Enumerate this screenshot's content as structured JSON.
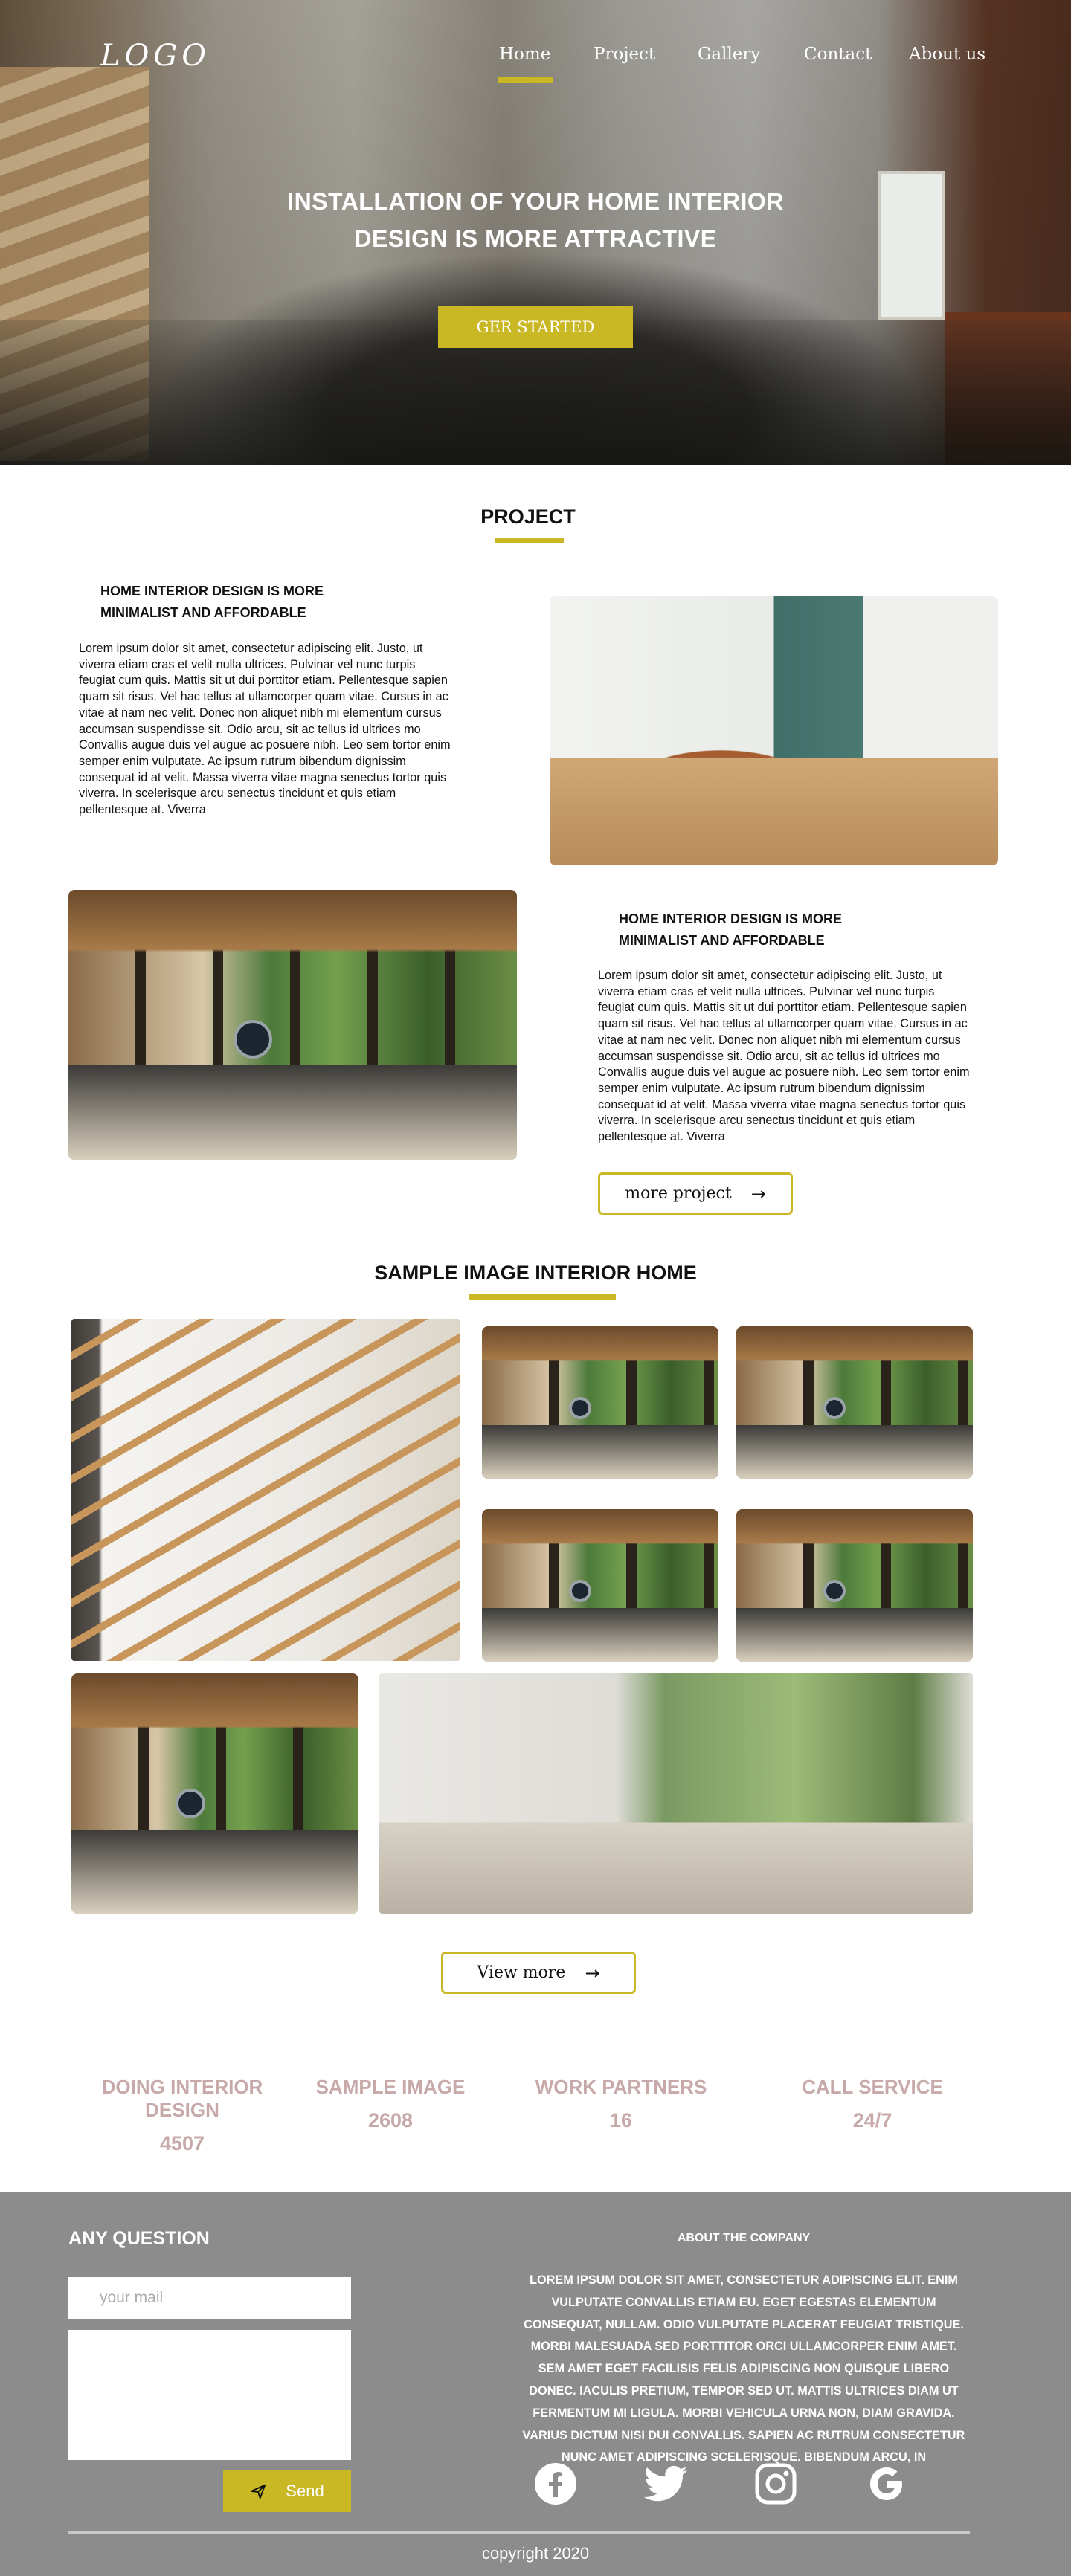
{
  "brand": {
    "logo": "LOGO",
    "accent": "#c9b723"
  },
  "nav": {
    "items": [
      "Home",
      "Project",
      "Gallery",
      "Contact",
      "About us"
    ],
    "active": "Home"
  },
  "hero": {
    "title_line1": "INSTALLATION OF YOUR HOME INTERIOR",
    "title_line2": "DESIGN IS MORE ATTRACTIVE",
    "cta": "GER STARTED"
  },
  "project": {
    "title": "PROJECT",
    "block1": {
      "heading_line1": "HOME INTERIOR DESIGN IS MORE",
      "heading_line2": "MINIMALIST AND AFFORDABLE",
      "body": "Lorem ipsum dolor sit amet, consectetur adipiscing elit. Justo, ut viverra etiam cras et velit nulla ultrices. Pulvinar vel nunc turpis feugiat cum quis. Mattis sit ut dui porttitor etiam. Pellentesque sapien quam sit risus. Vel hac tellus at ullamcorper quam vitae. Cursus in ac vitae at nam nec velit. Donec non aliquet nibh mi elementum cursus accumsan suspendisse sit. Odio arcu, sit ac tellus id ultrices mo Convallis augue duis vel augue ac posuere nibh. Leo sem tortor enim semper enim vulputate. Ac ipsum rutrum bibendum dignissim consequat id at velit. Massa viverra vitae magna senectus tortor quis viverra. In scelerisque arcu senectus tincidunt et quis etiam pellentesque at. Viverra"
    },
    "block2": {
      "heading_line1": "HOME INTERIOR DESIGN IS MORE",
      "heading_line2": "MINIMALIST AND AFFORDABLE",
      "body": "Lorem ipsum dolor sit amet, consectetur adipiscing elit. Justo, ut viverra etiam cras et velit nulla ultrices. Pulvinar vel nunc turpis feugiat cum quis. Mattis sit ut dui porttitor etiam. Pellentesque sapien quam sit risus. Vel hac tellus at ullamcorper quam vitae. Cursus in ac vitae at nam nec velit. Donec non aliquet nibh mi elementum cursus accumsan suspendisse sit. Odio arcu, sit ac tellus id ultrices mo Convallis augue duis vel augue ac posuere nibh. Leo sem tortor enim semper enim vulputate. Ac ipsum rutrum bibendum dignissim consequat id at velit. Massa viverra vitae magna senectus tortor quis viverra. In scelerisque arcu senectus tincidunt et quis etiam pellentesque at. Viverra"
    },
    "more_button": "more project"
  },
  "gallery": {
    "title": "SAMPLE IMAGE INTERIOR HOME",
    "view_more": "View more"
  },
  "stats": [
    {
      "label": "DOING INTERIOR DESIGN",
      "value": "4507"
    },
    {
      "label": "SAMPLE IMAGE",
      "value": "2608"
    },
    {
      "label": "WORK PARTNERS",
      "value": "16"
    },
    {
      "label": "CALL SERVICE",
      "value": "24/7"
    }
  ],
  "footer": {
    "question_title": "ANY QUESTION",
    "mail_placeholder": "your mail",
    "send_label": "Send",
    "about_title": "ABOUT THE COMPANY",
    "about_text": "LOREM IPSUM DOLOR SIT AMET, CONSECTETUR ADIPISCING ELIT. ENIM VULPUTATE CONVALLIS ETIAM EU. EGET EGESTAS ELEMENTUM CONSEQUAT, NULLAM. ODIO VULPUTATE PLACERAT FEUGIAT TRISTIQUE. MORBI MALESUADA SED PORTTITOR ORCI ULLAMCORPER ENIM AMET. SEM AMET EGET FACILISIS FELIS ADIPISCING NON QUISQUE LIBERO DONEC. IACULIS PRETIUM, TEMPOR SED UT. MATTIS ULTRICES DIAM UT FERMENTUM MI LIGULA. MORBI VEHICULA URNA NON, DIAM GRAVIDA. VARIUS DICTUM NISI DUI CONVALLIS. SAPIEN AC RUTRUM CONSECTETUR NUNC AMET ADIPISCING SCELERISQUE. BIBENDUM ARCU, IN",
    "social_icons": [
      "facebook-icon",
      "twitter-icon",
      "instagram-icon",
      "google-icon"
    ],
    "copyright": "copyright 2020"
  }
}
